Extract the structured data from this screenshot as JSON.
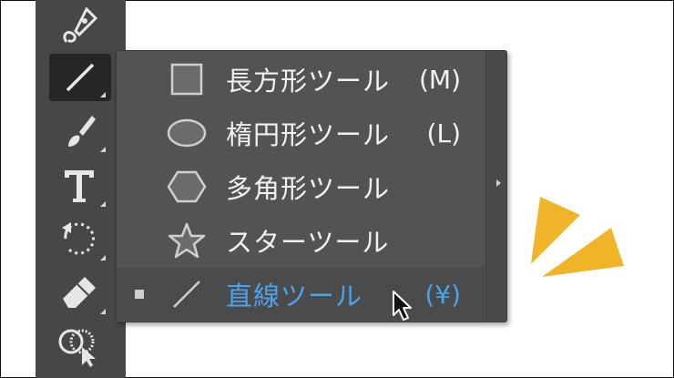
{
  "toolbar": {
    "tools": [
      {
        "name": "pen-tool",
        "icon": "pen-nib-icon"
      },
      {
        "name": "line-segment-tool",
        "icon": "line-icon",
        "active": true
      },
      {
        "name": "paintbrush-tool",
        "icon": "brush-icon"
      },
      {
        "name": "type-tool",
        "icon": "type-t-icon"
      },
      {
        "name": "rotate-tool",
        "icon": "rotate-icon"
      },
      {
        "name": "eraser-tool",
        "icon": "eraser-icon"
      },
      {
        "name": "shape-builder-tool",
        "icon": "shape-builder-icon"
      }
    ]
  },
  "flyout": {
    "items": [
      {
        "icon": "rectangle-icon",
        "label": "長方形ツール",
        "shortcut": "(M)",
        "selected": false
      },
      {
        "icon": "ellipse-icon",
        "label": "楕円形ツール",
        "shortcut": "(L)",
        "selected": false
      },
      {
        "icon": "polygon-icon",
        "label": "多角形ツール",
        "shortcut": "",
        "selected": false
      },
      {
        "icon": "star-icon",
        "label": "スターツール",
        "shortcut": "",
        "selected": false
      },
      {
        "icon": "line-icon",
        "label": "直線ツール",
        "shortcut": "(¥)",
        "selected": true
      }
    ]
  },
  "colors": {
    "toolbar_bg": "#474747",
    "flyout_bg": "#535353",
    "selected_text": "#4aa3ee",
    "accent_decoration": "#efb428"
  }
}
